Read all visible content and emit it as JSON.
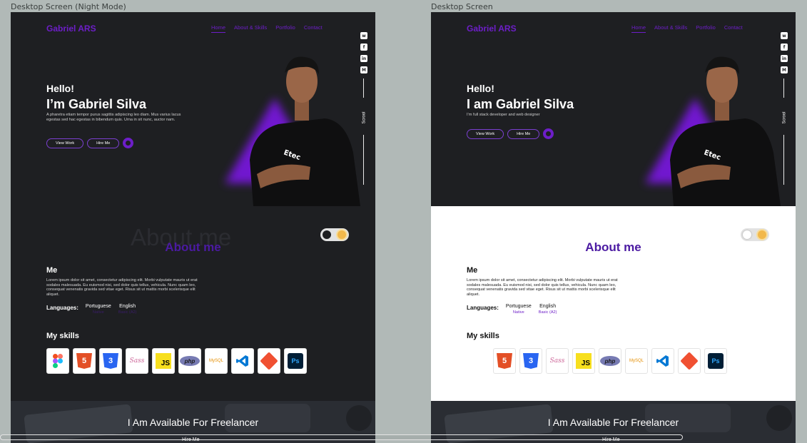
{
  "frames": [
    {
      "label": "Desktop Screen (Night Mode)",
      "brand": "Gabriel ARS",
      "nav": [
        "Home",
        "About & Skills",
        "Portfolio",
        "Contact"
      ],
      "scroll_label": "Scrool",
      "hero": {
        "hello": "Hello!",
        "name": "I’m Gabriel Silva",
        "description": "A pharetra etiam tempor purus sagittis adipiscing leo diam. Mus varius lacus egestas sed hac egestas in bibendum quis. Urna in sit nunc, auctor nam.",
        "buttons": [
          "View Work",
          "Hire Me"
        ]
      },
      "about": {
        "ghost_title": "About me",
        "title": "About me",
        "me_heading": "Me",
        "me_text": "Lorem ipsum dolor sit amet, consectetur adipiscing elit. Morbi vulputate mauris ut erat sodales malesuada. Eu euismod nisi, sed dolor quis tellus, vehicula. Nunc quam leo, consequat venenatis gravida sed vitae eget. Risus sit ut mattis morbi scelerisque elit aliquet.",
        "languages_label": "Languages:",
        "languages": [
          {
            "name": "Portuguese",
            "level": "Native"
          },
          {
            "name": "English",
            "level": "Basic (A2)"
          }
        ],
        "skills_heading": "My skills"
      },
      "freelancer": {
        "title": "I Am Available For Freelancer",
        "button": "Hire Me"
      }
    },
    {
      "label": "Desktop Screen",
      "brand": "Gabriel ARS",
      "nav": [
        "Home",
        "About & Skills",
        "Portfolio",
        "Contact"
      ],
      "scroll_label": "Scrool",
      "hero": {
        "hello": "Hello!",
        "name": "I am Gabriel Silva",
        "description": "I’m full stack developer and web designer",
        "buttons": [
          "View Work",
          "Hire Me"
        ]
      },
      "about": {
        "title": "About me",
        "me_heading": "Me",
        "me_text": "Lorem ipsum dolor sit amet, consectetur adipiscing elit. Morbi vulputate mauris ut erat sodales malesuada. Eu euismod nisi, sed dolor quis tellus, vehicula. Nunc quam leo, consequat venenatis gravida sed vitae eget. Risus sit ut mattis morbi scelerisque elit aliquet.",
        "languages_label": "Languages:",
        "languages": [
          {
            "name": "Portuguese",
            "level": "Native"
          },
          {
            "name": "English",
            "level": "Basic (A2)"
          }
        ],
        "skills_heading": "My skills"
      },
      "freelancer": {
        "title": "I Am Available For Freelancer",
        "button": "Hire Me"
      }
    }
  ],
  "skills": [
    {
      "icon": "figma-icon",
      "glyph": ""
    },
    {
      "icon": "html5-icon",
      "glyph": "5"
    },
    {
      "icon": "css3-icon",
      "glyph": "3"
    },
    {
      "icon": "sass-icon",
      "glyph": "Sass"
    },
    {
      "icon": "javascript-icon",
      "glyph": "JS"
    },
    {
      "icon": "php-icon",
      "glyph": "php"
    },
    {
      "icon": "mysql-icon",
      "glyph": "MySQL"
    },
    {
      "icon": "vscode-icon",
      "glyph": ""
    },
    {
      "icon": "git-icon",
      "glyph": ""
    },
    {
      "icon": "photoshop-icon",
      "glyph": "Ps"
    }
  ],
  "skill_badges": {
    "html": "HTML",
    "css": "CSS"
  },
  "colors": {
    "accent": "#6d1ec8",
    "dark_bg": "#1e1f22",
    "light_bg": "#ffffff",
    "canvas": "#b1b9b7"
  }
}
